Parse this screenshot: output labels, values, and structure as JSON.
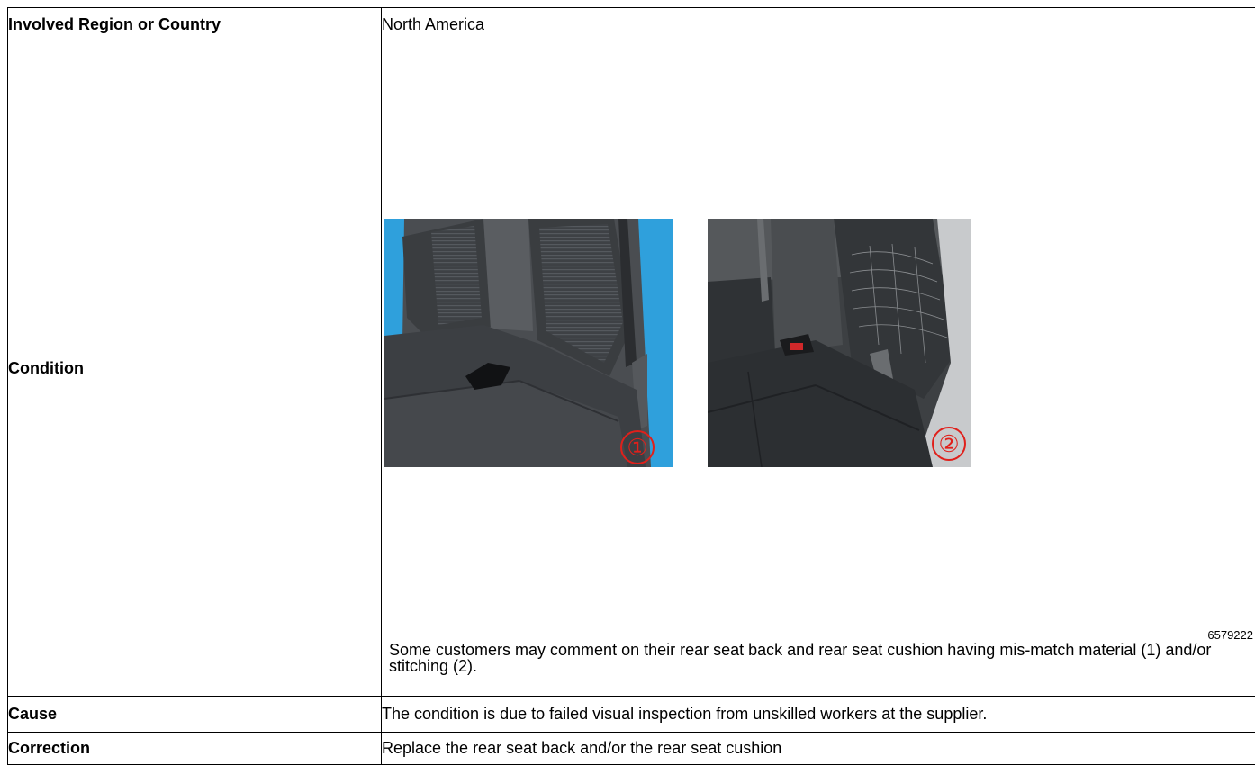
{
  "rows": {
    "region": {
      "label": "Involved Region or Country",
      "value": "North America"
    },
    "condition": {
      "label": "Condition",
      "figure_id": "6579222",
      "marker_1": "①",
      "marker_2": "②",
      "text": "Some customers may comment on their rear seat back and rear seat cushion having mis-match material (1) and/or stitching (2)."
    },
    "cause": {
      "label": "Cause",
      "value": "The condition is due to failed visual inspection from unskilled workers at the supplier."
    },
    "correction": {
      "label": "Correction",
      "value": "Replace the rear seat back and/or the rear seat cushion"
    }
  },
  "colors": {
    "border": "#000000",
    "marker": "#e0201b",
    "vehicle_blue": "#2fa0dc"
  }
}
